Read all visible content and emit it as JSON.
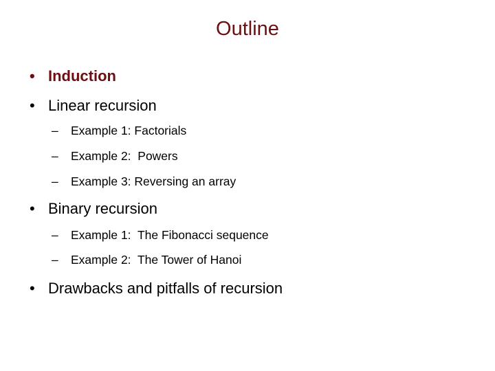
{
  "slide": {
    "title": "Outline",
    "accent_color": "#6b0f12",
    "bullet_glyph": "•",
    "dash_glyph": "–",
    "items": [
      {
        "level": 1,
        "text": "Induction",
        "highlighted": true
      },
      {
        "level": 1,
        "text": "Linear recursion"
      },
      {
        "level": 2,
        "text": "Example 1: Factorials"
      },
      {
        "level": 2,
        "text": "Example 2:  Powers"
      },
      {
        "level": 2,
        "text": "Example 3: Reversing an array"
      },
      {
        "level": 1,
        "text": "Binary recursion"
      },
      {
        "level": 2,
        "text": "Example 1:  The Fibonacci sequence"
      },
      {
        "level": 2,
        "text": "Example 2:  The Tower of Hanoi"
      },
      {
        "level": 1,
        "text": "Drawbacks and pitfalls of recursion"
      }
    ]
  }
}
